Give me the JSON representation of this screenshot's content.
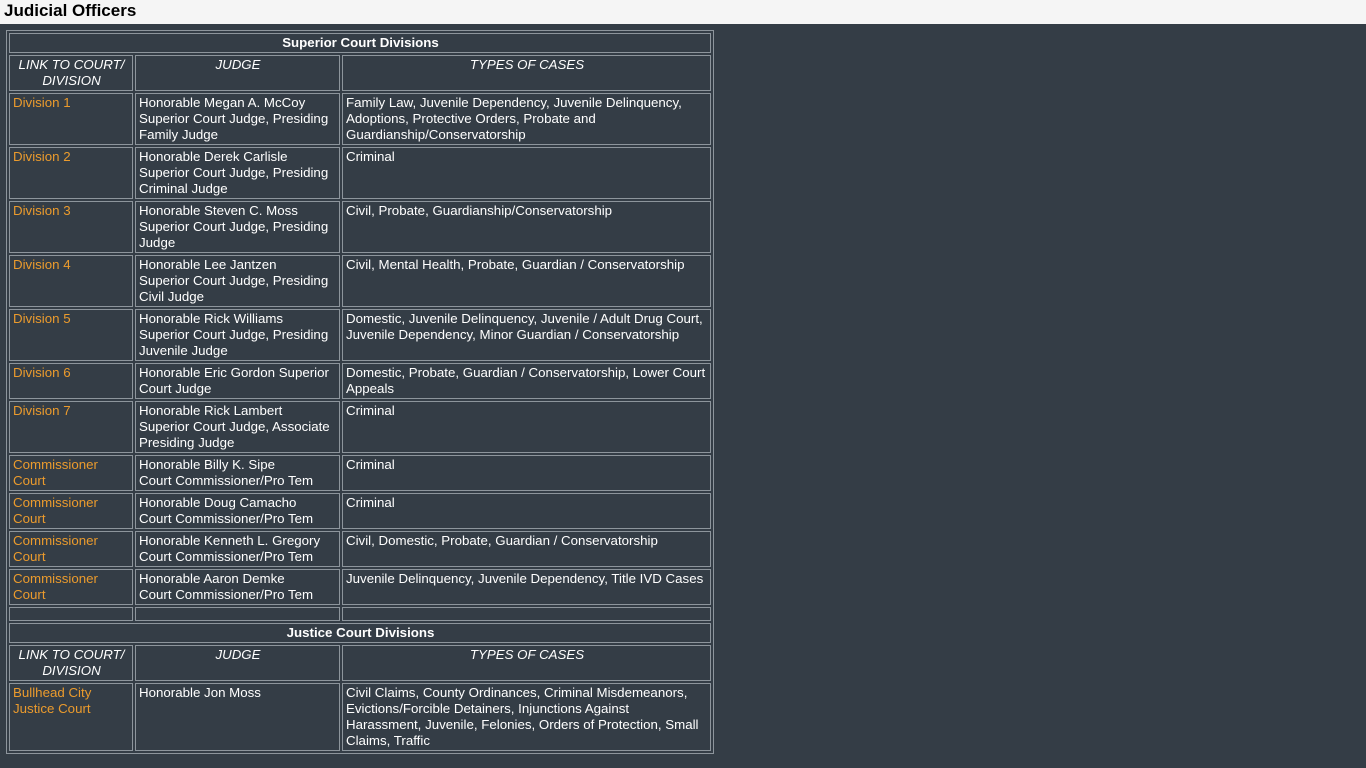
{
  "page": {
    "title": "Judicial Officers",
    "link_color": "#eb9b2d",
    "background_color": "#343d46",
    "header_band_color": "#1f2533",
    "border_color": "#8d959c",
    "text_color": "#ffffff",
    "title_bar_color": "#f5f5f5"
  },
  "tables": [
    {
      "section_title": "Superior Court Divisions",
      "columns": [
        "LINK TO COURT/ DIVISION",
        "JUDGE",
        "TYPES OF CASES"
      ],
      "rows": [
        {
          "link": "Division 1",
          "judge_name": "Honorable Megan A. McCoy",
          "judge_role": "Superior Court Judge, Presiding Family Judge",
          "cases": "Family Law, Juvenile Dependency, Juvenile Delinquency, Adoptions, Protective Orders, Probate and Guardianship/Conservatorship"
        },
        {
          "link": "Division 2",
          "judge_name": "Honorable Derek Carlisle",
          "judge_role": "Superior Court Judge, Presiding Criminal Judge",
          "cases": "Criminal"
        },
        {
          "link": "Division 3",
          "judge_name": "Honorable Steven C. Moss",
          "judge_role": "Superior Court Judge, Presiding Judge",
          "cases": "Civil, Probate, Guardianship/Conservatorship"
        },
        {
          "link": "Division 4",
          "judge_name": "Honorable Lee Jantzen",
          "judge_role": "Superior Court Judge, Presiding Civil Judge",
          "cases": "Civil, Mental Health, Probate, Guardian / Conservatorship"
        },
        {
          "link": "Division 5",
          "judge_name": "Honorable Rick Williams",
          "judge_role": "Superior Court Judge, Presiding Juvenile Judge",
          "cases": "Domestic, Juvenile Delinquency, Juvenile / Adult Drug Court, Juvenile Dependency, Minor Guardian / Conservatorship"
        },
        {
          "link": "Division 6",
          "judge_name": "Honorable Eric Gordon Superior Court Judge",
          "judge_role": "",
          "cases": "Domestic, Probate, Guardian / Conservatorship, Lower Court Appeals"
        },
        {
          "link": "Division 7",
          "judge_name": "Honorable Rick Lambert",
          "judge_role": "Superior Court Judge, Associate Presiding Judge",
          "cases": "Criminal"
        },
        {
          "link": "Commissioner Court",
          "judge_name": "Honorable Billy K. Sipe",
          "judge_role": "Court Commissioner/Pro Tem",
          "cases": "Criminal"
        },
        {
          "link": "Commissioner Court",
          "judge_name": "Honorable Doug Camacho",
          "judge_role": "Court Commissioner/Pro Tem",
          "cases": "Criminal"
        },
        {
          "link": "Commissioner Court",
          "judge_name": "Honorable Kenneth L. Gregory",
          "judge_role": "Court Commissioner/Pro Tem",
          "cases": "Civil, Domestic, Probate, Guardian / Conservatorship"
        },
        {
          "link": "Commissioner Court",
          "judge_name": "Honorable Aaron Demke",
          "judge_role": "Court Commissioner/Pro Tem",
          "cases": "Juvenile Delinquency, Juvenile Dependency, Title IVD Cases"
        }
      ]
    },
    {
      "section_title": "Justice Court Divisions",
      "columns": [
        "LINK TO COURT/ DIVISION",
        "JUDGE",
        "TYPES OF CASES"
      ],
      "rows": [
        {
          "link": "Bullhead City Justice Court",
          "judge_name": "Honorable Jon Moss",
          "judge_role": "",
          "cases": "Civil Claims, County Ordinances, Criminal Misdemeanors, Evictions/Forcible Detainers, Injunctions Against Harassment, Juvenile, Felonies, Orders of Protection, Small Claims, Traffic"
        }
      ]
    }
  ]
}
